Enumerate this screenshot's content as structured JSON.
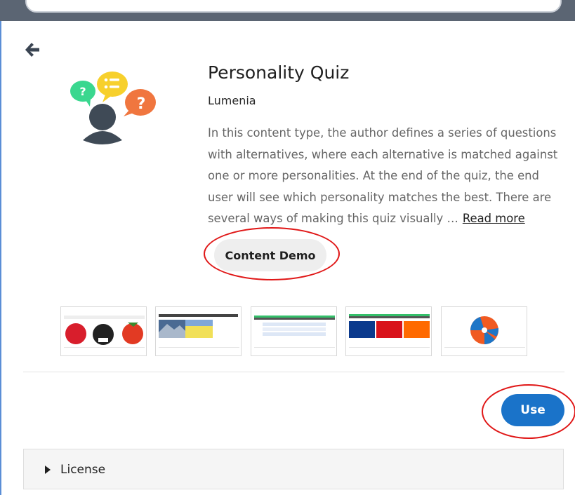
{
  "content_type": {
    "title": "Personality Quiz",
    "owner": "Lumenia",
    "description_lines": [
      "In this content type, the author defines a series of questions",
      "with alternatives, where each alternative is matched against",
      "one or more personalities. At the end of the quiz, the end",
      "user will see which personality matches the best. There are",
      "several ways of making this quiz visually …"
    ],
    "read_more": "Read more",
    "demo_button": "Content Demo",
    "use_button": "Use",
    "license_label": "License"
  },
  "icons": {
    "back": "arrow-left-icon",
    "logo": "personality-quiz-logo",
    "license_toggle": "caret-right-icon"
  },
  "colors": {
    "accent": "#1a73c9",
    "annotation": "#e01717",
    "topbar": "#5b6573"
  }
}
